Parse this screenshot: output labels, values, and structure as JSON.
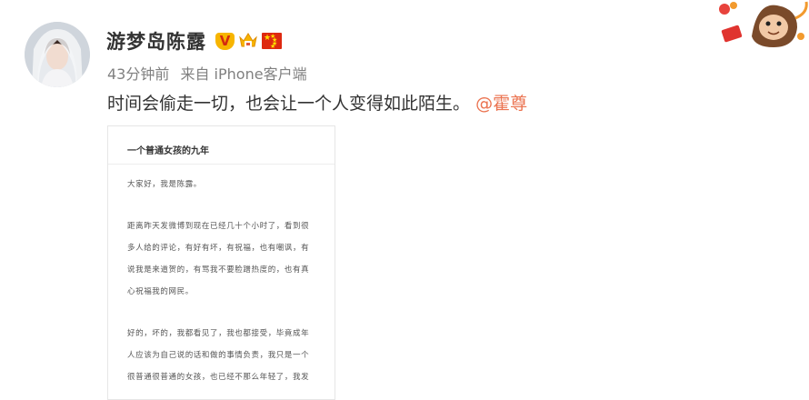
{
  "user": {
    "name": "游梦岛陈露",
    "badges": [
      "verified-v-icon",
      "vip-crown-icon",
      "china-flag-icon"
    ]
  },
  "meta": {
    "time": "43分钟前",
    "source": "来自 iPhone客户端"
  },
  "post": {
    "text": "时间会偷走一切，也会让一个人变得如此陌生。",
    "mention": "@霍尊"
  },
  "article": {
    "title": "一个普通女孩的九年",
    "lines": [
      "大家好，我是陈露。",
      "距离昨天发微博到现在已经几十个小时了，看到很",
      "多人给的评论，有好有坏，有祝福，也有嘲讽，有",
      "说我是来道贺的，有骂我不要脸蹭热度的，也有真",
      "心祝福我的网民。",
      "好的，坏的，我都看见了，我也都接受，毕竟成年",
      "人应该为自己说的话和做的事情负责，我只是一个",
      "很普通很普通的女孩，也已经不那么年轻了，我发"
    ]
  },
  "colors": {
    "name": "#333333",
    "meta": "#808080",
    "mention": "#eb7350",
    "vip_gold": "#f7b500",
    "flag_red": "#de2910"
  }
}
